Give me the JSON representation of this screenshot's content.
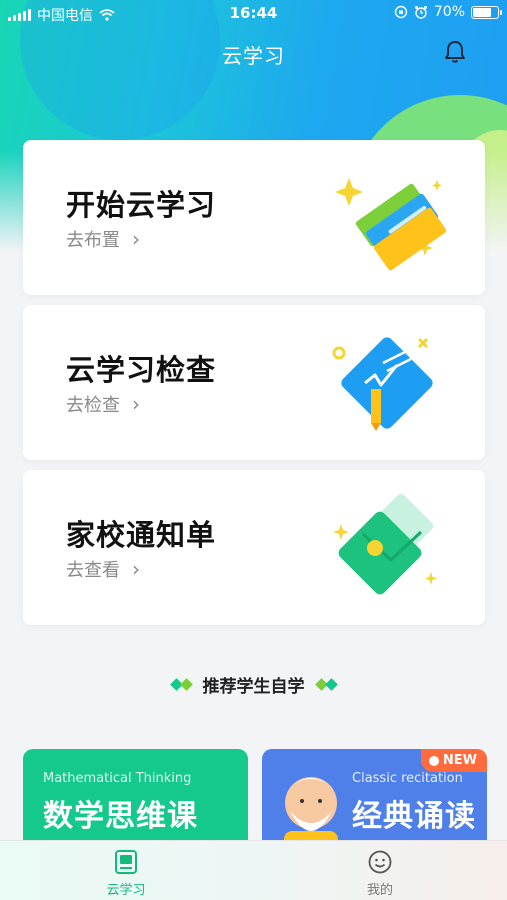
{
  "status_bar": {
    "carrier": "中国电信",
    "time": "16:44",
    "battery_percent": "70%",
    "battery_level": 0.7
  },
  "nav": {
    "title": "云学习",
    "bell_icon": "bell-icon"
  },
  "cards": [
    {
      "title": "开始云学习",
      "subtitle": "去布置",
      "icon": "books-icon"
    },
    {
      "title": "云学习检查",
      "subtitle": "去检查",
      "icon": "check-paper-icon"
    },
    {
      "title": "家校通知单",
      "subtitle": "去查看",
      "icon": "envelope-icon"
    }
  ],
  "recommend": {
    "title": "推荐学生自学"
  },
  "courses": [
    {
      "en": "Mathematical Thinking",
      "cn": "数学思维课"
    },
    {
      "en": "Classic recitation",
      "cn": "经典诵读",
      "badge": "NEW"
    }
  ],
  "tabs": [
    {
      "label": "云学习",
      "icon": "study-icon",
      "active": true
    },
    {
      "label": "我的",
      "icon": "smiley-icon",
      "active": false
    }
  ],
  "colors": {
    "accent_green": "#14c98b",
    "accent_blue": "#4f7fe8",
    "badge_orange": "#ff6b3d"
  }
}
